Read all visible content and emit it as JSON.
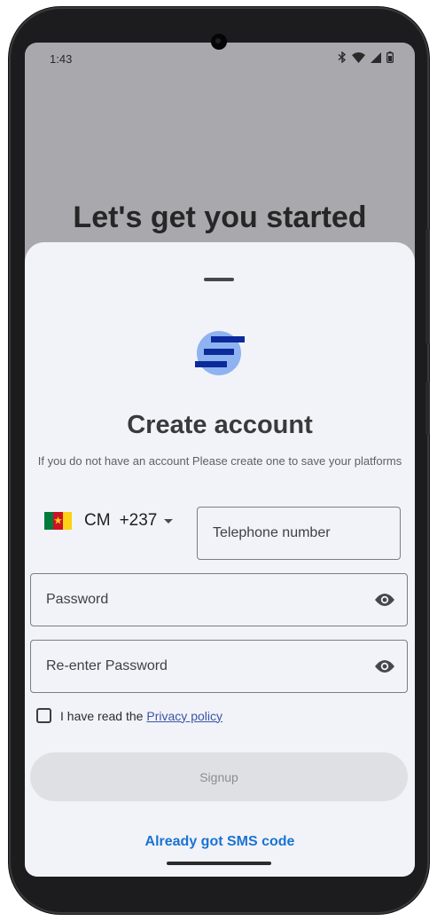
{
  "status_bar": {
    "time": "1:43",
    "icons": [
      "bluetooth-icon",
      "wifi-icon",
      "signal-icon",
      "battery-icon"
    ]
  },
  "background": {
    "title": "Let's get you started"
  },
  "sheet": {
    "title": "Create account",
    "subtitle": "If you do not have an account Please create one to save your platforms",
    "country": {
      "code": "CM",
      "dial_code": "+237",
      "flag_colors": [
        "#007a3d",
        "#ce1126",
        "#fcd116"
      ]
    },
    "phone": {
      "placeholder": "Telephone number"
    },
    "password": {
      "placeholder": "Password"
    },
    "repassword": {
      "placeholder": "Re-enter Password"
    },
    "privacy": {
      "text": "I have read the",
      "link_label": "Privacy policy",
      "checked": false
    },
    "signup_label": "Signup",
    "sms_link_label": "Already got SMS code"
  },
  "colors": {
    "accent_blue": "#1a73d1",
    "logo_dark": "#0b2a9b",
    "logo_light": "#8fb3f1",
    "sheet_bg": "#f2f3f8"
  }
}
